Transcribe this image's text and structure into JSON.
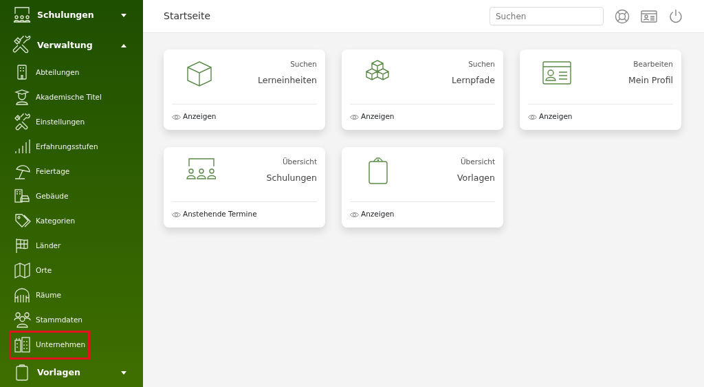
{
  "sidebar": {
    "groups": [
      {
        "label": "Schulungen",
        "expanded": false
      },
      {
        "label": "Verwaltung",
        "expanded": true,
        "children": [
          {
            "label": "Abteilungen",
            "highlighted": false
          },
          {
            "label": "Akademische Titel",
            "highlighted": false
          },
          {
            "label": "Einstellungen",
            "highlighted": false
          },
          {
            "label": "Erfahrungsstufen",
            "highlighted": false
          },
          {
            "label": "Feiertage",
            "highlighted": false
          },
          {
            "label": "Gebäude",
            "highlighted": false
          },
          {
            "label": "Kategorien",
            "highlighted": false
          },
          {
            "label": "Länder",
            "highlighted": false
          },
          {
            "label": "Orte",
            "highlighted": false
          },
          {
            "label": "Räume",
            "highlighted": false
          },
          {
            "label": "Stammdaten",
            "highlighted": false
          },
          {
            "label": "Unternehmen",
            "highlighted": true
          }
        ]
      },
      {
        "label": "Vorlagen",
        "expanded": false
      }
    ]
  },
  "header": {
    "title": "Startseite",
    "search": {
      "placeholder": "Suchen"
    }
  },
  "cards": [
    {
      "caption": "Suchen",
      "title": "Lerneinheiten",
      "link": "Anzeigen"
    },
    {
      "caption": "Suchen",
      "title": "Lernpfade",
      "link": "Anzeigen"
    },
    {
      "caption": "Bearbeiten",
      "title": "Mein Profil",
      "link": "Anzeigen"
    },
    {
      "caption": "Übersicht",
      "title": "Schulungen",
      "link": "Anstehende Termine"
    },
    {
      "caption": "Übersicht",
      "title": "Vorlagen",
      "link": "Anzeigen"
    }
  ]
}
